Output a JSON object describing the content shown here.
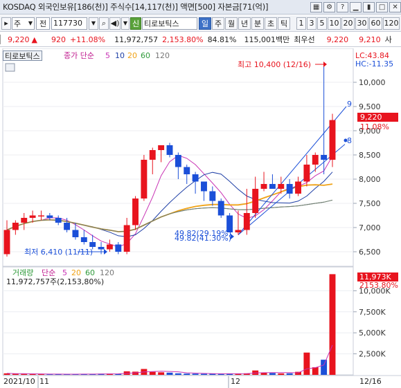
{
  "titlebar": {
    "title": "KOSDAQ 외국인보유[186(천)] 주식수[14,117(천)] 액면[500] 자본금[71(억)]",
    "icons": [
      "grid-icon",
      "gear-icon",
      "help-icon",
      "minimize-icon",
      "pin-icon",
      "maximize-icon",
      "close-icon"
    ]
  },
  "toolbar": {
    "market": "주",
    "all_label": "전",
    "code": "117730",
    "stock_name": "티로보틱스",
    "new_label": "신",
    "periods": [
      "일",
      "주",
      "월",
      "년",
      "분",
      "초",
      "틱"
    ],
    "intervals": [
      "1",
      "3",
      "5",
      "10",
      "20",
      "30",
      "60",
      "120"
    ]
  },
  "quote": {
    "price": "9,220",
    "change": "920",
    "change_pct": "+11.08%",
    "volume": "11,972,757",
    "volume_pct": "2,153.80%",
    "ratio": "84.81%",
    "amount": "115,001백만",
    "best_label": "최우선",
    "ask": "9,220",
    "bid": "9,210",
    "tail": "사"
  },
  "price_panel": {
    "name_box": "티로보틱스",
    "legend_label": "종가 단순",
    "ma": [
      "5",
      "10",
      "20",
      "60",
      "120"
    ],
    "lc": "LC:43.84",
    "hc": "HC:-11.35",
    "high_note": "최고 10,400 (12/16)",
    "low_note": "최저 6,410 (11/11)",
    "fib_a": "49.82(29.19%)",
    "fib_b": "49.82(41.30%)",
    "last_price": "9,220",
    "last_pct": "11.08%",
    "line_nine": "9",
    "line_eight": "8",
    "y_ticks": [
      "10,000",
      "9,500",
      "9,000",
      "8,500",
      "8,000",
      "7,500",
      "7,000",
      "6,500"
    ]
  },
  "volume_panel": {
    "label": "거래량",
    "legend_label": "단순",
    "ma": [
      "5",
      "20",
      "60",
      "120"
    ],
    "summary": "11,972,757주(2,153,80%)",
    "last_vol": "11,973K",
    "last_pct": "2153.80%",
    "y_ticks": [
      "10,000K",
      "7,500K",
      "5,000K",
      "2,500K"
    ]
  },
  "x_axis": {
    "labels": [
      "2021/10",
      "11",
      "12",
      "12/16"
    ]
  },
  "colors": {
    "up": "#e8141e",
    "down": "#1b4fd8",
    "ma5": "#c832b4",
    "ma10": "#1e3fa6",
    "ma20": "#f0a215",
    "ma60": "#2f9a3a",
    "ma120": "#777777"
  },
  "chart_data": {
    "type": "candlestick",
    "x": [
      "10/25",
      "10/26",
      "10/27",
      "10/28",
      "10/29",
      "11/1",
      "11/2",
      "11/3",
      "11/4",
      "11/5",
      "11/8",
      "11/9",
      "11/10",
      "11/11",
      "11/12",
      "11/15",
      "11/16",
      "11/17",
      "11/18",
      "11/19",
      "11/22",
      "11/23",
      "11/24",
      "11/25",
      "11/26",
      "11/29",
      "11/30",
      "12/1",
      "12/2",
      "12/3",
      "12/6",
      "12/7",
      "12/8",
      "12/9",
      "12/10",
      "12/13",
      "12/14",
      "12/15",
      "12/16"
    ],
    "open": [
      6450,
      6950,
      7100,
      7200,
      7250,
      7250,
      7200,
      7100,
      6950,
      6800,
      6700,
      6600,
      6550,
      6650,
      6500,
      7050,
      7600,
      8400,
      8600,
      8700,
      8500,
      8250,
      8100,
      7950,
      7750,
      7550,
      7250,
      6900,
      6950,
      7300,
      7800,
      7900,
      7800,
      7900,
      7700,
      7950,
      8300,
      8500,
      8400
    ],
    "high": [
      7150,
      7150,
      7300,
      7350,
      7350,
      7300,
      7250,
      7200,
      7100,
      6950,
      6850,
      6700,
      6750,
      6700,
      7200,
      7650,
      8500,
      8650,
      8650,
      8750,
      8550,
      8300,
      8150,
      7950,
      7850,
      7600,
      7300,
      7350,
      7800,
      8050,
      8150,
      8100,
      8050,
      8000,
      8050,
      8500,
      8550,
      10400,
      9350
    ],
    "low": [
      6400,
      6850,
      6950,
      7100,
      7150,
      7150,
      7050,
      6900,
      6750,
      6650,
      6550,
      6450,
      6500,
      6450,
      6450,
      6950,
      7550,
      8100,
      8350,
      8450,
      8000,
      7900,
      7700,
      7550,
      7450,
      7200,
      6900,
      6850,
      6850,
      7200,
      7750,
      7800,
      7700,
      7600,
      7650,
      7850,
      8150,
      8100,
      8250
    ],
    "close": [
      6950,
      7100,
      7200,
      7250,
      7250,
      7200,
      7100,
      6950,
      6800,
      6700,
      6600,
      6550,
      6650,
      6500,
      7050,
      7600,
      8400,
      8600,
      8700,
      8500,
      8250,
      8100,
      7950,
      7750,
      7550,
      7250,
      6900,
      6950,
      7300,
      7800,
      7900,
      7800,
      7900,
      7700,
      7950,
      8300,
      8500,
      8400,
      9220
    ],
    "volume": [
      180,
      120,
      110,
      90,
      80,
      70,
      85,
      95,
      80,
      110,
      90,
      140,
      150,
      120,
      420,
      380,
      700,
      360,
      300,
      260,
      180,
      150,
      140,
      120,
      130,
      110,
      160,
      140,
      180,
      520,
      260,
      220,
      170,
      180,
      360,
      2650,
      900,
      1800,
      11973
    ],
    "ylim": [
      6200,
      10700
    ],
    "volume_ylim": [
      0,
      12500
    ],
    "volume_unit": "K"
  }
}
